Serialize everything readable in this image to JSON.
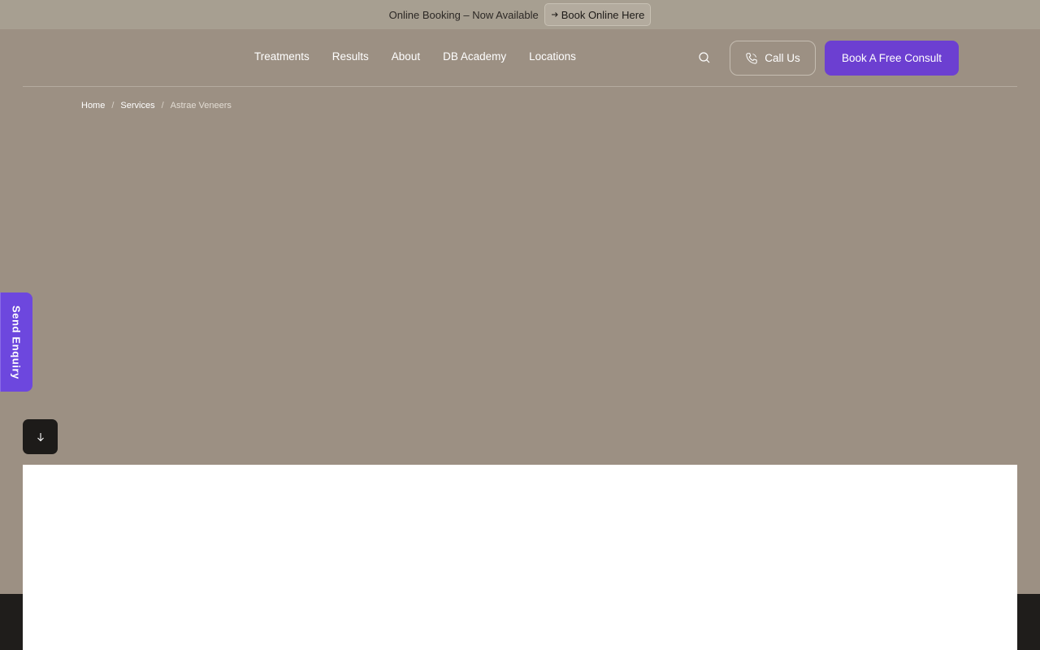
{
  "announcement": {
    "text": "Online Booking – Now Available",
    "link_label": "Book Online Here",
    "link_icon": "arrow-right-icon"
  },
  "nav": {
    "items": [
      {
        "label": "Treatments"
      },
      {
        "label": "Results"
      },
      {
        "label": "About"
      },
      {
        "label": "DB Academy"
      },
      {
        "label": "Locations"
      }
    ],
    "search_icon": "search-icon",
    "call_label": "Call Us",
    "call_icon": "phone-icon",
    "consult_label": "Book A Free Consult"
  },
  "breadcrumb": {
    "items": [
      {
        "label": "Home"
      },
      {
        "label": "Services"
      },
      {
        "label": "Astrae Veneers"
      }
    ],
    "separator": "/"
  },
  "side_tab": {
    "label": "Send Enquiry"
  },
  "scroll_button": {
    "icon": "arrow-down-icon"
  },
  "colors": {
    "accent": "#6c3fd1",
    "hero_bg": "#9c9083",
    "announce_bg": "#a79f91"
  }
}
